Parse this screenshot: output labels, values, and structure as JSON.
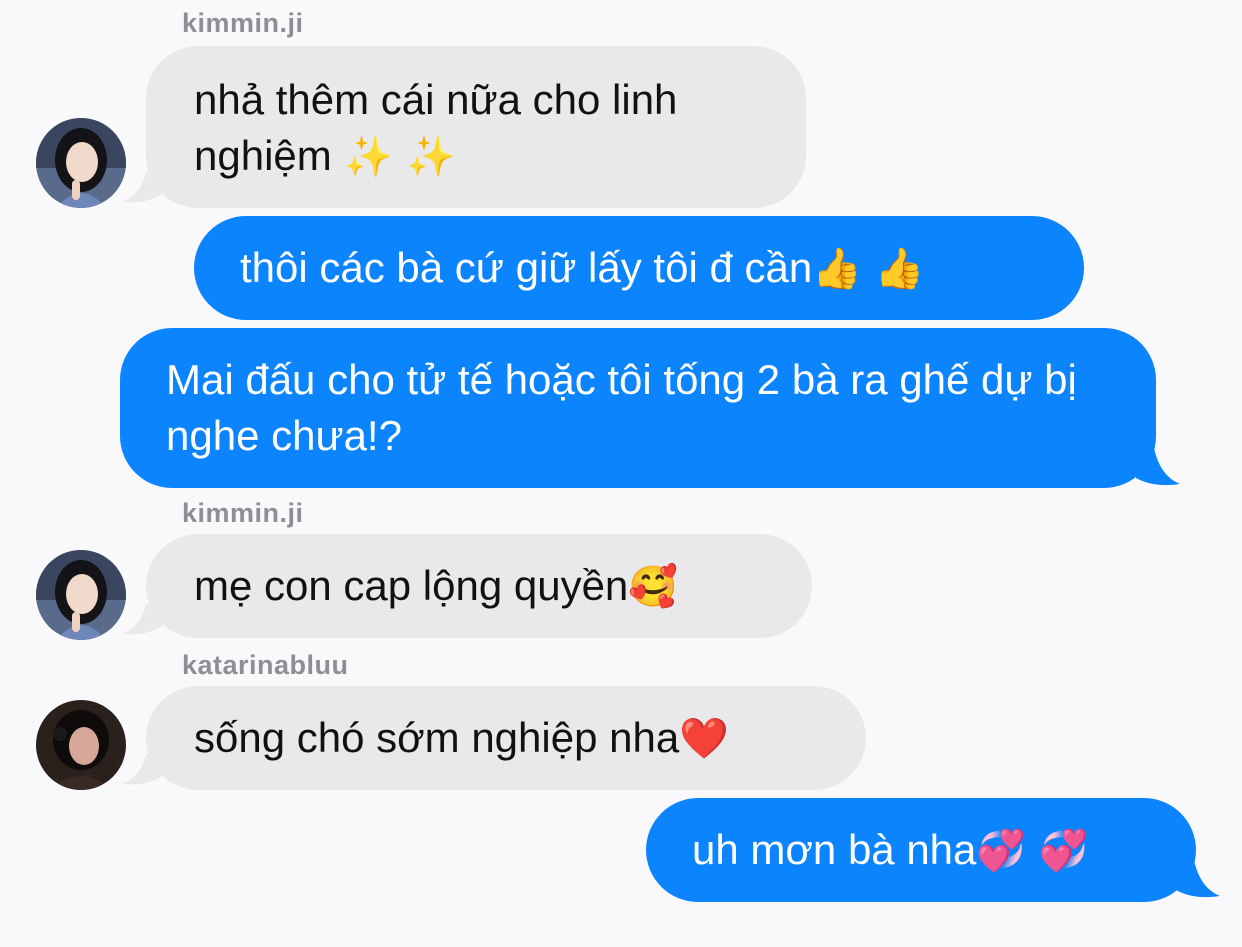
{
  "messages": [
    {
      "id": 1,
      "direction": "incoming",
      "sender": "kimmin.ji",
      "text": "nhả thêm cái nữa cho linh nghiệm",
      "emoji": "✨ ✨"
    },
    {
      "id": 2,
      "direction": "outgoing",
      "text": "thôi các bà cứ giữ lấy tôi đ cần",
      "emoji": "👍 👍"
    },
    {
      "id": 3,
      "direction": "outgoing",
      "text": "Mai đấu cho tử tế hoặc tôi tống 2 bà ra ghế dự bị nghe chưa!?"
    },
    {
      "id": 4,
      "direction": "incoming",
      "sender": "kimmin.ji",
      "text": "mẹ con cap lộng quyền",
      "emoji": "🥰"
    },
    {
      "id": 5,
      "direction": "incoming",
      "sender": "katarinabluu",
      "text": "sống chó sớm nghiệp nha",
      "emoji": "❤️"
    },
    {
      "id": 6,
      "direction": "outgoing",
      "text": "uh mơn bà nha",
      "emoji": "💞 💞"
    }
  ],
  "colors": {
    "outgoing_bubble": "#0b84fe",
    "incoming_bubble": "#e9e9eb",
    "background": "#f9f9fb",
    "sender_name": "#8e8e93"
  }
}
